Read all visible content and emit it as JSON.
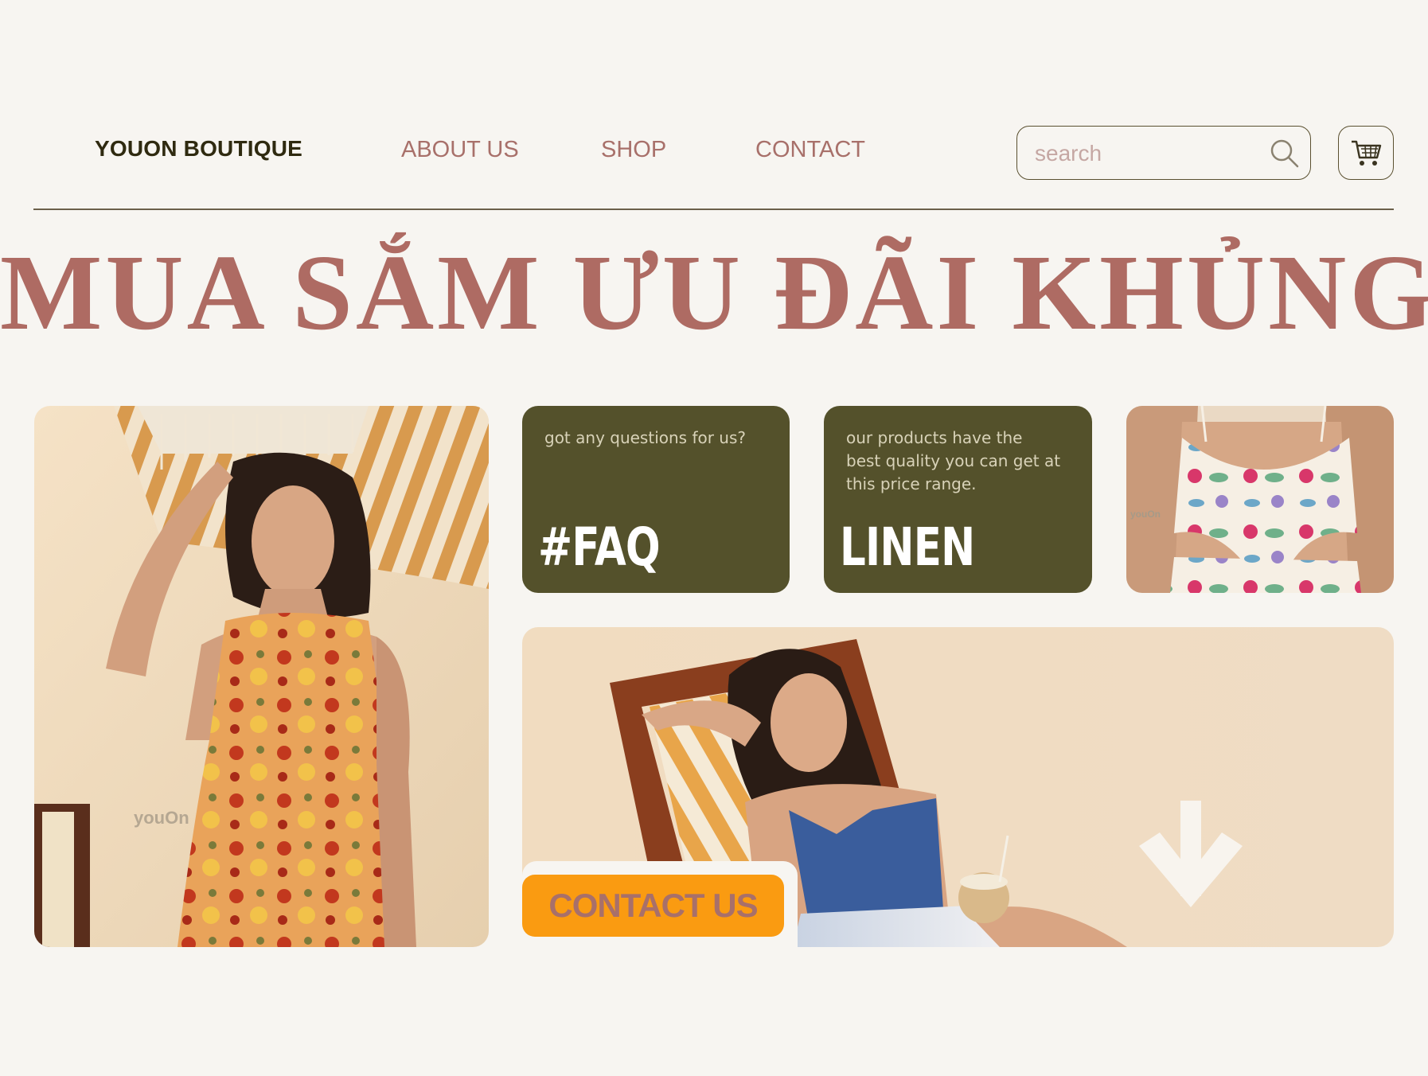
{
  "header": {
    "logo": "YOUON BOUTIQUE",
    "nav": [
      {
        "label": "ABOUT US"
      },
      {
        "label": "SHOP"
      },
      {
        "label": "CONTACT"
      }
    ],
    "search": {
      "placeholder": "search",
      "icon": "search-icon"
    },
    "cart": {
      "icon": "cart-icon"
    }
  },
  "hero": {
    "headline": "MUA SẮM ƯU ĐÃI KHỦNG"
  },
  "cards": {
    "faq": {
      "text": "got any questions for us?",
      "tag": "#FAQ"
    },
    "linen": {
      "text": "our products have the best quality you can get at this price range.",
      "tag": "LINEN"
    }
  },
  "banner": {
    "cta_label": "CONTACT US",
    "arrow_icon": "arrow-down-icon"
  },
  "watermarks": {
    "photo_left": "youOn",
    "photo_top_right": "youOn"
  },
  "colors": {
    "background": "#f7f5f1",
    "headline": "#ae6b63",
    "nav": "#a8706a",
    "olive": "#54512b",
    "cta": "#fa9b11"
  }
}
